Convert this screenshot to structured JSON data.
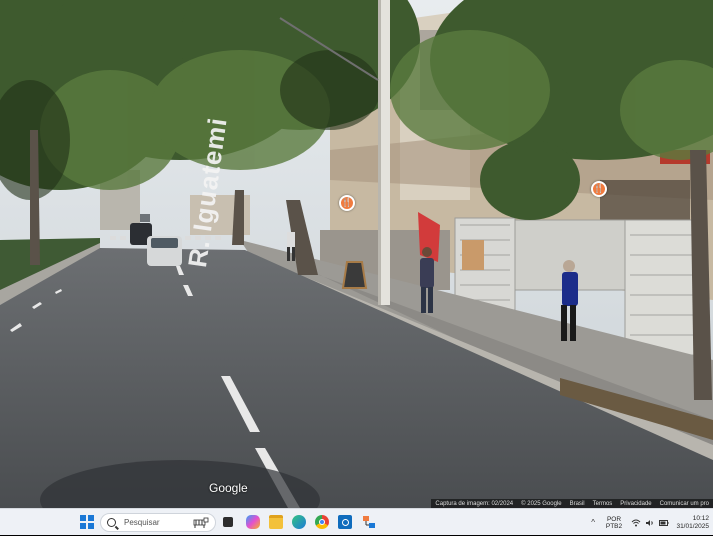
{
  "street_view": {
    "street_name": "R. Iguatemi",
    "logo": "Google",
    "footer": {
      "capture": "Captura de imagem: 02/2024",
      "copyright": "© 2025 Google",
      "country": "Brasil",
      "terms": "Termos",
      "privacy": "Privacidade",
      "share": "Comunicar um pro"
    },
    "poi_markers": [
      "restaurant-pin",
      "restaurant-pin"
    ]
  },
  "taskbar": {
    "search_placeholder": "Pesquisar",
    "apps": [
      "start-icon",
      "task-view-icon",
      "copilot-icon",
      "file-explorer-icon",
      "edge-icon",
      "chrome-icon",
      "outlook-icon",
      "network-app-icon"
    ],
    "language": "POR",
    "layout": "PTB2",
    "time": "10:12",
    "date": "31/01/2025"
  },
  "colors": {
    "accent": "#1a78d6",
    "poi": "#f07b3f",
    "taskbar": "#eef1f6"
  }
}
